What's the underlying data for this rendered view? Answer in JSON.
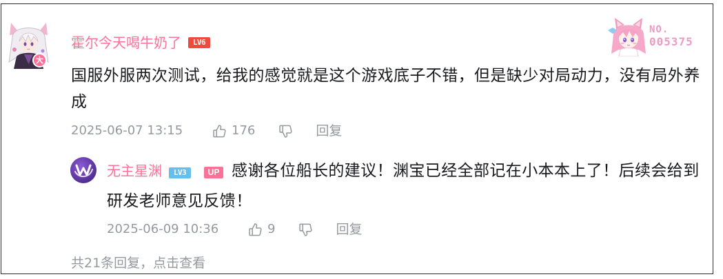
{
  "comment": {
    "username": "霍尔今天喝牛奶了",
    "level": "LV6",
    "avatar_badge": "大",
    "fan_card": {
      "prefix": "NO.",
      "number": "005375"
    },
    "text": "国服外服两次测试，给我的感觉就是这个游戏底子不错，但是缺少对局动力，没有局外养成",
    "time": "2025-06-07 13:15",
    "like_count": "176",
    "reply_label": "回复"
  },
  "reply": {
    "username": "无主星渊",
    "level": "LV3",
    "role_badge": "UP",
    "text": "感谢各位船长的建议！渊宝已经全部记在小本本上了！后续会给到研发老师意见反馈！",
    "time": "2025-06-09 10:36",
    "like_count": "9",
    "reply_label": "回复"
  },
  "view_more": "共21条回复，点击查看",
  "icons": {
    "like": "thumbs-up-icon",
    "dislike": "thumbs-down-icon"
  },
  "colors": {
    "username": "#FB7299",
    "text": "#18191C",
    "meta": "#9499A0",
    "level_6": "#EE4B3F",
    "level_3": "#66BEEB",
    "up_badge": "#FB7299",
    "vip_badge": "#FB7299",
    "fan_card_text": "#E99CC4",
    "border": "#2A2A2A"
  }
}
